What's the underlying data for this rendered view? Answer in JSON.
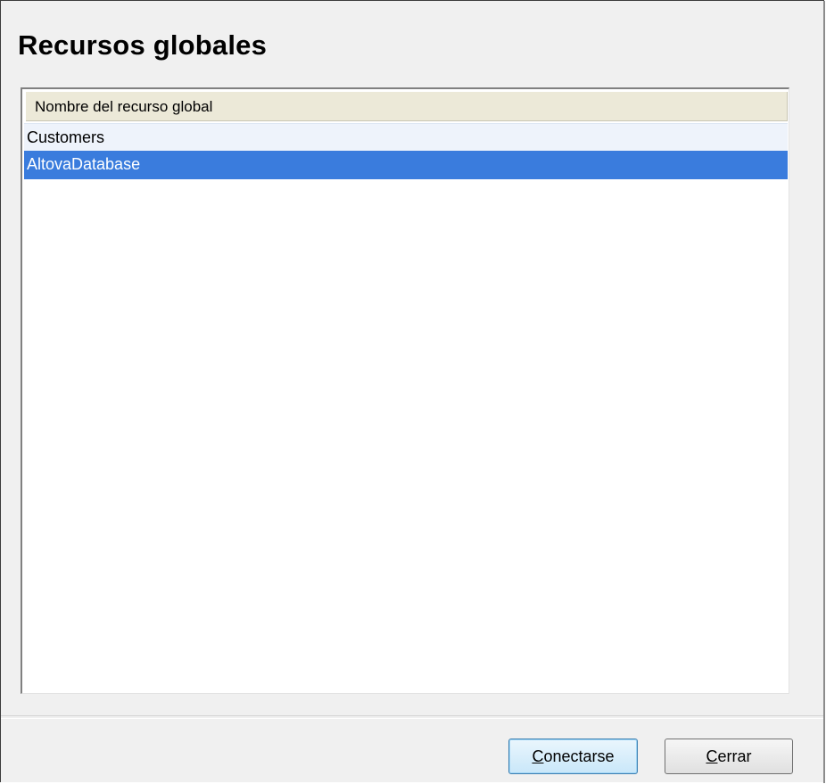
{
  "dialog": {
    "title": "Recursos globales"
  },
  "list": {
    "column_header": "Nombre del recurso global",
    "items": [
      {
        "label": "Customers",
        "selected": false
      },
      {
        "label": "AltovaDatabase",
        "selected": true
      }
    ],
    "selection_color": "#3a7cdd"
  },
  "buttons": {
    "connect": {
      "accel": "C",
      "rest": "onectarse"
    },
    "close": {
      "accel": "C",
      "rest": "errar"
    }
  }
}
